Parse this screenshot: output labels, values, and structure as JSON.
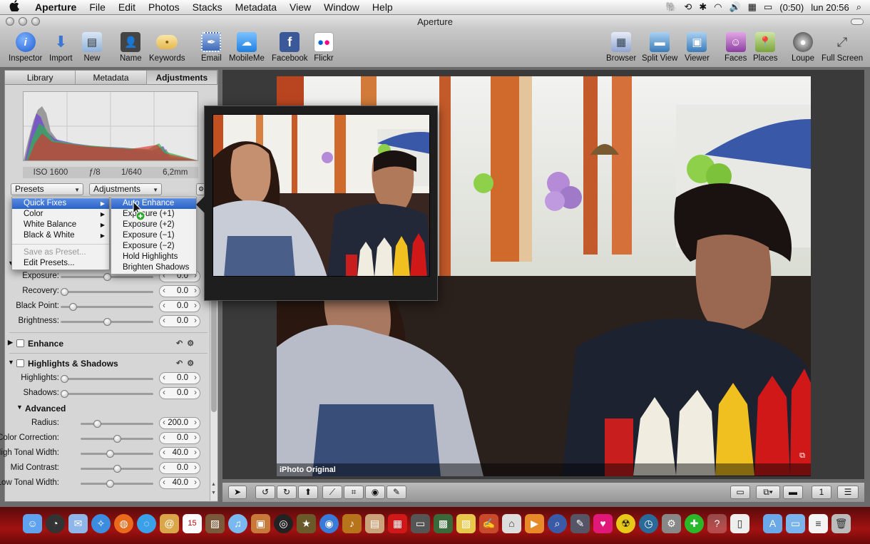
{
  "menubar": {
    "apple": "",
    "app_name": "Aperture",
    "items": [
      "File",
      "Edit",
      "Photos",
      "Stacks",
      "Metadata",
      "View",
      "Window",
      "Help"
    ],
    "battery": "(0:50)",
    "clock": "lun 20:56"
  },
  "window": {
    "title": "Aperture"
  },
  "toolbar": {
    "inspector": "Inspector",
    "import": "Import",
    "new": "New",
    "name": "Name",
    "keywords": "Keywords",
    "email": "Email",
    "mobileme": "MobileMe",
    "facebook": "Facebook",
    "flickr": "Flickr",
    "browser": "Browser",
    "split_view": "Split View",
    "viewer": "Viewer",
    "faces": "Faces",
    "places": "Places",
    "loupe": "Loupe",
    "full_screen": "Full Screen"
  },
  "tabs": [
    "Library",
    "Metadata",
    "Adjustments"
  ],
  "exif": {
    "iso": "ISO 1600",
    "aperture": "ƒ/8",
    "shutter": "1/640",
    "focal": "6,2mm"
  },
  "presets_label": "Presets",
  "adjustments_label": "Adjustments",
  "exposure_rows": [
    {
      "label": "Exposure:",
      "value": "0.0",
      "knob": 0.5
    },
    {
      "label": "Recovery:",
      "value": "0.0",
      "knob": 0.0
    },
    {
      "label": "Black Point:",
      "value": "0.0",
      "knob": 0.1
    },
    {
      "label": "Brightness:",
      "value": "0.0",
      "knob": 0.5
    }
  ],
  "enhance": {
    "name": "Enhance"
  },
  "highlights": {
    "name": "Highlights & Shadows"
  },
  "hs_rows": [
    {
      "label": "Highlights:",
      "value": "0.0",
      "knob": 0.0
    },
    {
      "label": "Shadows:",
      "value": "0.0",
      "knob": 0.0
    }
  ],
  "advanced": {
    "name": "Advanced"
  },
  "adv_rows": [
    {
      "label": "Radius:",
      "value": "200.0",
      "knob": 0.2
    },
    {
      "label": "Color Correction:",
      "value": "0.0",
      "knob": 0.5
    },
    {
      "label": "High Tonal Width:",
      "value": "40.0",
      "knob": 0.4
    },
    {
      "label": "Mid Contrast:",
      "value": "0.0",
      "knob": 0.5
    },
    {
      "label": "Low Tonal Width:",
      "value": "40.0",
      "knob": 0.4
    }
  ],
  "presets_menu": {
    "items": [
      "Quick Fixes",
      "Color",
      "White Balance",
      "Black & White"
    ],
    "save": "Save as Preset...",
    "edit": "Edit Presets..."
  },
  "quickfix_menu": [
    "Auto Enhance",
    "Exposure (+1)",
    "Exposure (+2)",
    "Exposure (−1)",
    "Exposure (−2)",
    "Hold Highlights",
    "Brighten Shadows"
  ],
  "photo_label": "iPhoto Original",
  "colors": {
    "selection": "#2a62c9",
    "dock": "#a31212"
  }
}
